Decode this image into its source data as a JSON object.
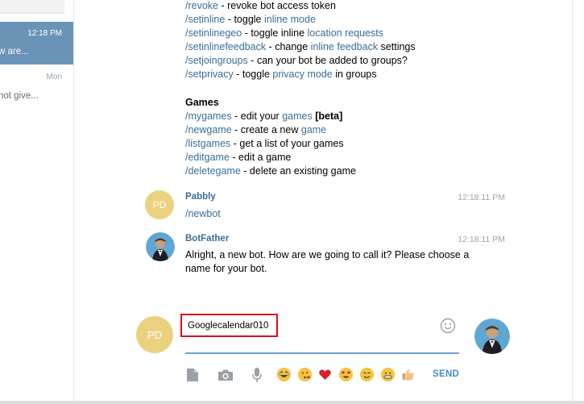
{
  "chat_list": {
    "items": [
      {
        "time": "12:18 PM",
        "preview": "w are...",
        "active": true
      },
      {
        "time": "Mon",
        "preview": "not give...",
        "active": false
      }
    ]
  },
  "commands_top": [
    {
      "cmd": "/revoke",
      "sep": " - ",
      "parts": [
        {
          "t": "revoke bot access token",
          "link": false
        }
      ]
    },
    {
      "cmd": "/setinline",
      "sep": " - ",
      "parts": [
        {
          "t": "toggle ",
          "link": false
        },
        {
          "t": "inline mode",
          "link": true
        }
      ]
    },
    {
      "cmd": "/setinlinegeo",
      "sep": " - ",
      "parts": [
        {
          "t": "toggle inline ",
          "link": false
        },
        {
          "t": "location requests",
          "link": true
        }
      ]
    },
    {
      "cmd": "/setinlinefeedback",
      "sep": " - ",
      "parts": [
        {
          "t": "change ",
          "link": false
        },
        {
          "t": "inline feedback",
          "link": true
        },
        {
          "t": " settings",
          "link": false
        }
      ]
    },
    {
      "cmd": "/setjoingroups",
      "sep": " - ",
      "parts": [
        {
          "t": "can your bot be added to groups?",
          "link": false
        }
      ]
    },
    {
      "cmd": "/setprivacy",
      "sep": " - ",
      "parts": [
        {
          "t": "toggle ",
          "link": false
        },
        {
          "t": "privacy mode",
          "link": true
        },
        {
          "t": " in groups",
          "link": false
        }
      ]
    }
  ],
  "games_heading": "Games",
  "commands_games": [
    {
      "cmd": "/mygames",
      "sep": " - ",
      "parts": [
        {
          "t": "edit your ",
          "link": false
        },
        {
          "t": "games",
          "link": true
        },
        {
          "t": " ",
          "link": false
        },
        {
          "t": "[beta]",
          "link": false,
          "bold": true
        }
      ]
    },
    {
      "cmd": "/newgame",
      "sep": " - ",
      "parts": [
        {
          "t": "create a new ",
          "link": false
        },
        {
          "t": "game",
          "link": true
        }
      ]
    },
    {
      "cmd": "/listgames",
      "sep": " - ",
      "parts": [
        {
          "t": "get a list of your games",
          "link": false
        }
      ]
    },
    {
      "cmd": "/editgame",
      "sep": " - ",
      "parts": [
        {
          "t": "edit a game",
          "link": false
        }
      ]
    },
    {
      "cmd": "/deletegame",
      "sep": " - ",
      "parts": [
        {
          "t": "delete an existing game",
          "link": false
        }
      ]
    }
  ],
  "messages": [
    {
      "avatar_initials": "PD",
      "sender": "Pabbly",
      "time": "12:18:11 PM",
      "text": "/newbot"
    },
    {
      "avatar_icon": "botfather-avatar-icon",
      "sender": "BotFather",
      "time": "12:18:11 PM",
      "text_line1": "Alright, a new bot. How are we going to call it? Please choose a",
      "text_line2": "name for your bot."
    }
  ],
  "composer": {
    "avatar_initials": "PD",
    "value": "Googlecalendar010",
    "send_label": "SEND",
    "tools": [
      "attach-file-icon",
      "camera-icon",
      "microphone-icon"
    ],
    "emoji_icons": [
      "joy-emoji-icon",
      "kissing-heart-emoji-icon",
      "red-heart-icon",
      "heart-eyes-emoji-icon",
      "smile-emoji-icon",
      "grin-emoji-icon",
      "thumbs-up-icon"
    ],
    "emoji_panel_icon": "smiley-outline-icon"
  },
  "colors": {
    "link": "#3a6d99",
    "active_chat": "#6a93b8",
    "avatar_pd": "#ecd17f",
    "input_border": "#d6101c",
    "send": "#4c8bc7"
  }
}
